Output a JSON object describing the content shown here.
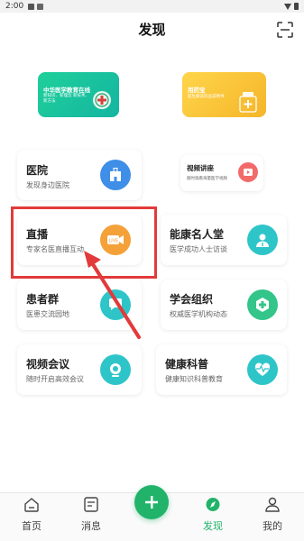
{
  "status": {
    "time": "2:00"
  },
  "header": {
    "title": "发现"
  },
  "banners": [
    {
      "title": "中华医学教育在线",
      "subtitle": "新知识、新理念 新技术、新方法"
    },
    {
      "title": "用药宝",
      "subtitle": "医生解读药品说明书"
    }
  ],
  "cards": {
    "hospital": {
      "title": "医院",
      "subtitle": "发现身边医院"
    },
    "video_lecture": {
      "title": "视频讲座",
      "subtitle": "随时观看海量医学视频"
    },
    "live": {
      "title": "直播",
      "subtitle": "专家名医直播互动"
    },
    "famous": {
      "title": "能康名人堂",
      "subtitle": "医学成功人士访谈"
    },
    "patients": {
      "title": "患者群",
      "subtitle": "医患交流园地"
    },
    "society": {
      "title": "学会组织",
      "subtitle": "权威医学机构动态"
    },
    "video_meeting": {
      "title": "视频会议",
      "subtitle": "随时开启高效会议"
    },
    "science": {
      "title": "健康科普",
      "subtitle": "健康知识科普教育"
    }
  },
  "tabs": [
    {
      "label": "首页"
    },
    {
      "label": "消息"
    },
    {
      "label": "发现"
    },
    {
      "label": "我的"
    }
  ],
  "colors": {
    "accent": "#22b36b",
    "highlight": "#e23a3a",
    "icon_blue": "#3f8ee8",
    "icon_orange": "#f5a13a",
    "icon_teal": "#2ec5c9",
    "icon_green": "#34c58a",
    "icon_red": "#f26a6a"
  }
}
